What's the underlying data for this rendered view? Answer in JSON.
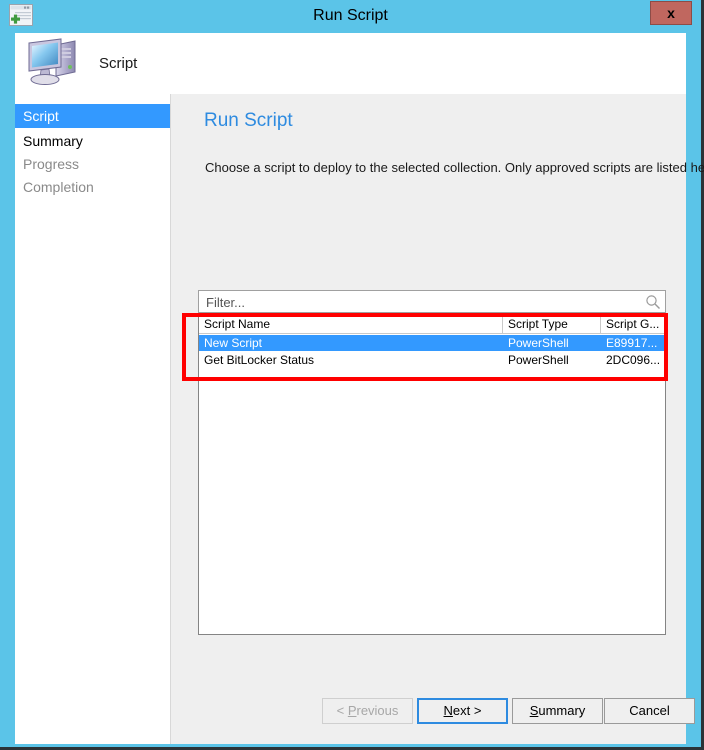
{
  "window": {
    "title": "Run Script",
    "title_icon": "script-window-icon",
    "close_label": "x",
    "frame_color": "#5BC4E8",
    "close_color": "#c0675f"
  },
  "header": {
    "label": "Script",
    "icon": "computer-icon"
  },
  "sidebar": {
    "items": [
      {
        "label": "Script",
        "state": "selected"
      },
      {
        "label": "Summary",
        "state": "normal"
      },
      {
        "label": "Progress",
        "state": "dim"
      },
      {
        "label": "Completion",
        "state": "dim"
      }
    ],
    "selected_color": "#3399FF"
  },
  "main": {
    "page_title": "Run Script",
    "page_title_color": "#2E8BE0",
    "instruction": "Choose a script to deploy to the selected collection. Only approved scripts are listed here.",
    "filter": {
      "value": "",
      "placeholder": "Filter...",
      "icon": "search-icon"
    },
    "list": {
      "columns": [
        {
          "label": "Script Name"
        },
        {
          "label": "Script Type"
        },
        {
          "label": "Script G..."
        }
      ],
      "rows": [
        {
          "name": "New Script",
          "type": "PowerShell",
          "guid": "E89917...",
          "selected": true
        },
        {
          "name": "Get BitLocker Status",
          "type": "PowerShell",
          "guid": "2DC096...",
          "selected": false
        }
      ]
    },
    "annotation": {
      "name": "red-highlight-box",
      "color": "#FF0000"
    }
  },
  "footer": {
    "buttons": [
      {
        "label": "< Previous",
        "acc_before": "< ",
        "acc": "P",
        "acc_after": "revious",
        "state": "disabled"
      },
      {
        "label": "Next >",
        "acc_before": "",
        "acc": "N",
        "acc_after": "ext >",
        "state": "focused"
      },
      {
        "label": "Summary",
        "acc_before": "",
        "acc": "S",
        "acc_after": "ummary",
        "state": "normal"
      },
      {
        "label": "Cancel",
        "acc_before": "",
        "acc": "",
        "acc_after": "Cancel",
        "state": "normal"
      }
    ]
  }
}
